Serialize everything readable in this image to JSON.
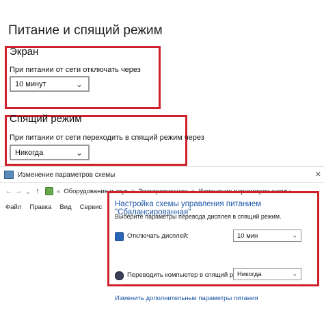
{
  "settings": {
    "page_title": "Питание и спящий режим",
    "screen": {
      "title": "Экран",
      "label": "При питании от сети отключать через",
      "value": "10 минут"
    },
    "sleep": {
      "title": "Спящий режим",
      "label": "При питании от сети переходить в спящий режим через",
      "value": "Никогда"
    }
  },
  "control_panel": {
    "window_title": "Изменение параметров схемы",
    "close_glyph": "✕",
    "nav": {
      "back": "←",
      "forward": "→",
      "down": "⌄",
      "up": "↑",
      "prefix": "«"
    },
    "breadcrumbs": [
      "Оборудование и звук",
      "Электропитание",
      "Изменение параметров схемы"
    ],
    "menu": [
      "Файл",
      "Правка",
      "Вид",
      "Сервис"
    ],
    "heading": "Настройка схемы управления питанием \"Сбалансированная\"",
    "subheading": "Выберите параметры перевода дисплея в спящий режим.",
    "display_off": {
      "label": "Отключать дисплей:",
      "value": "10 мин"
    },
    "sleep": {
      "label": "Переводить компьютер в спящий режим:",
      "value": "Никогда"
    },
    "advanced_link": "Изменить дополнительные параметры питания"
  },
  "colors": {
    "highlight_border": "#d0202b",
    "link": "#1a56a6"
  },
  "icons": [
    "chevron-down-icon",
    "app-icon",
    "close-icon",
    "back-arrow-icon",
    "forward-arrow-icon",
    "up-arrow-icon",
    "control-panel-icon",
    "monitor-icon",
    "moon-icon"
  ]
}
